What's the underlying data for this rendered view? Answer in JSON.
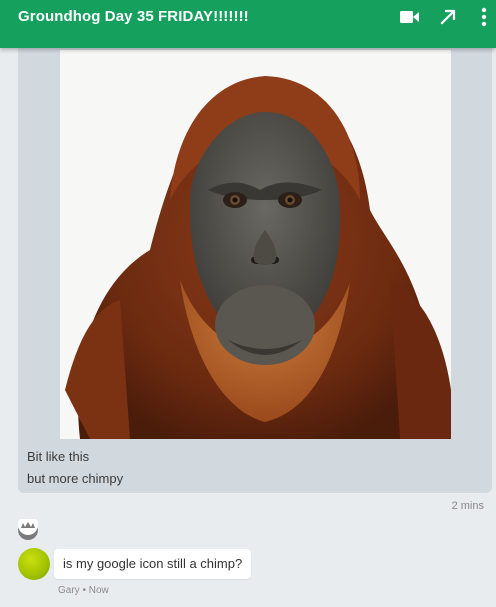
{
  "header": {
    "title": "Groundhog Day 35 FRIDAY!!!!!!!",
    "icons": [
      "video-call-icon",
      "pop-out-icon",
      "more-options-icon"
    ],
    "color": "#16a05d"
  },
  "conversation": {
    "shared_post": {
      "image": "orangutan-photo",
      "caption_line1": "Bit like this",
      "caption_line2": "but more chimpy",
      "time": "2 mins"
    },
    "message": {
      "text": "is my google icon still a chimp?",
      "sender": "Gary",
      "time": "Now"
    }
  }
}
